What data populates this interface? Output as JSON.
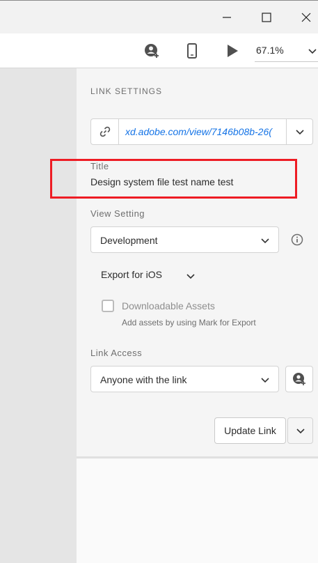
{
  "titlebar": {
    "icons": [
      "minimize-icon",
      "maximize-icon",
      "close-icon"
    ]
  },
  "toolbar": {
    "icons": [
      "share-user-icon",
      "mobile-device-icon",
      "play-icon"
    ],
    "zoom": "67.1%"
  },
  "panel": {
    "section_title": "LINK SETTINGS",
    "link_url": "xd.adobe.com/view/7146b08b-26(",
    "title_label": "Title",
    "title_value": "Design system file test name test",
    "view_setting_label": "View Setting",
    "view_setting_value": "Development",
    "export_label": "Export for iOS",
    "downloadable_label": "Downloadable Assets",
    "downloadable_checked": false,
    "downloadable_help": "Add assets by using Mark for Export",
    "link_access_label": "Link Access",
    "link_access_value": "Anyone with the link",
    "update_button": "Update Link"
  },
  "colors": {
    "link": "#1473e6",
    "highlight": "#ee1c24",
    "panel_bg": "#f5f5f5",
    "canvas_bg": "#e5e5e5"
  }
}
